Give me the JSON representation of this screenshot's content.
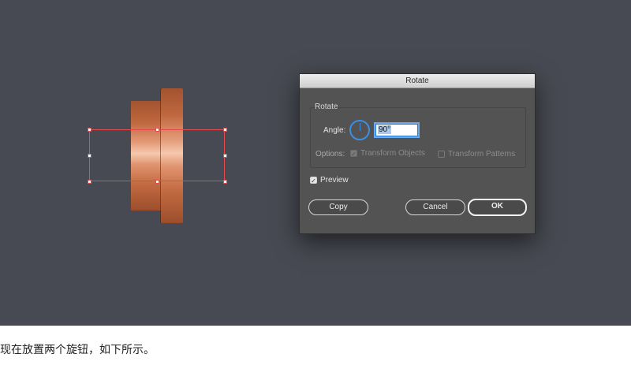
{
  "dialog": {
    "title": "Rotate",
    "group_label": "Rotate",
    "angle_label": "Angle:",
    "angle_value": "90°",
    "options_label": "Options:",
    "transform_objects_label": "Transform Objects",
    "transform_objects_checked": true,
    "transform_patterns_label": "Transform Patterns",
    "transform_patterns_checked": false,
    "preview_label": "Preview",
    "preview_checked": true,
    "copy_label": "Copy",
    "cancel_label": "Cancel",
    "ok_label": "OK"
  },
  "icons": {
    "check": "✓"
  },
  "colors": {
    "canvas_bg": "#474a52",
    "dialog_bg": "#535353",
    "selection": "#e5484d",
    "accent": "#3b8ee0"
  },
  "caption": "现在放置两个旋钮，如下所示。"
}
